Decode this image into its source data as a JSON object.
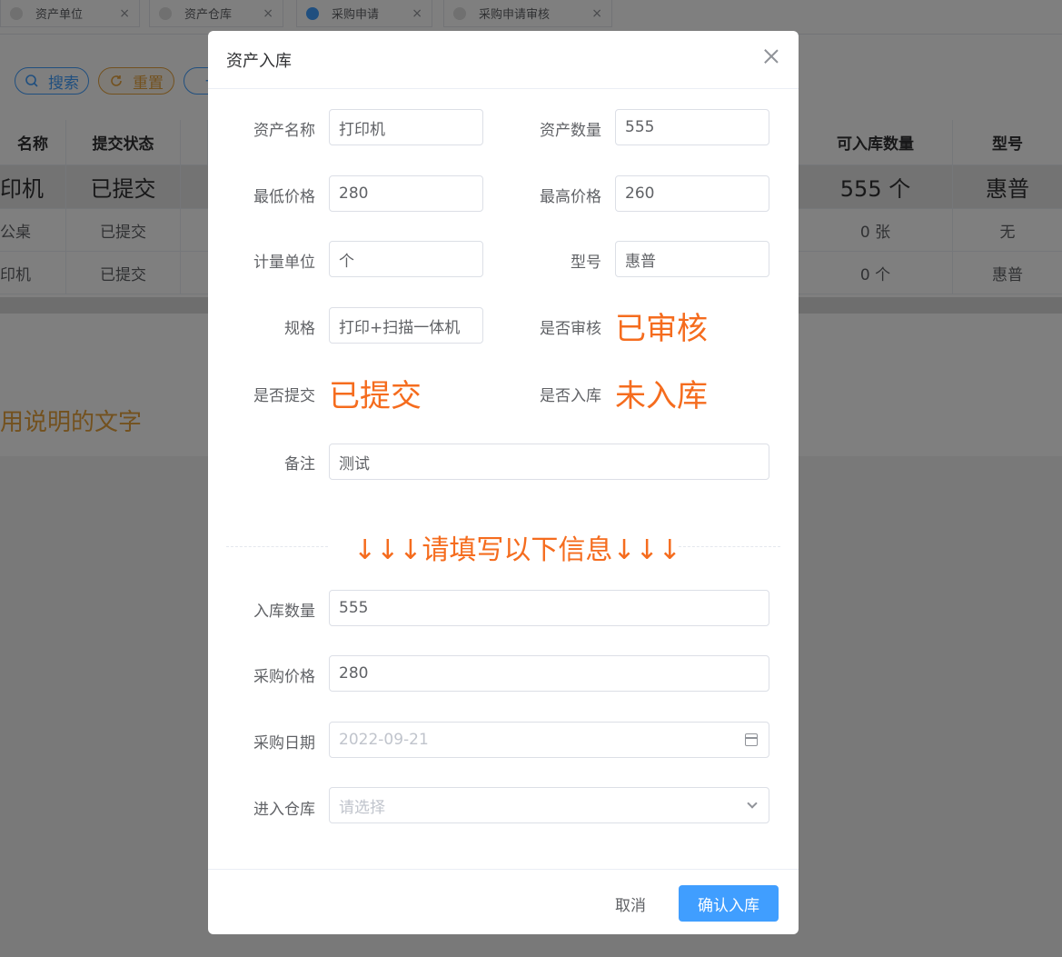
{
  "tabs": [
    {
      "label": "资产单位",
      "close": "×"
    },
    {
      "label": "资产仓库",
      "close": "×"
    },
    {
      "label": "采购申请",
      "close": "×"
    },
    {
      "label": "采购申请审核",
      "close": "×"
    }
  ],
  "toolbar": {
    "search_label": "搜索",
    "reset_label": "重置",
    "add_label": "+"
  },
  "table": {
    "headers": [
      "名称",
      "提交状态",
      "",
      "可入库数量",
      "型号"
    ],
    "rows": [
      [
        "印机",
        "已提交",
        "555 个",
        "惠普"
      ],
      [
        "公桌",
        "已提交",
        "0 张",
        "无"
      ],
      [
        "印机",
        "已提交",
        "0 个",
        "惠普"
      ]
    ]
  },
  "usage_text": "用说明的文字",
  "dialog": {
    "title": "资产入库",
    "fields": {
      "asset_name": {
        "label": "资产名称",
        "value": "打印机"
      },
      "asset_qty": {
        "label": "资产数量",
        "value": "555"
      },
      "min_price": {
        "label": "最低价格",
        "value": "280"
      },
      "max_price": {
        "label": "最高价格",
        "value": "260"
      },
      "unit": {
        "label": "计量单位",
        "value": "个"
      },
      "model": {
        "label": "型号",
        "value": "惠普"
      },
      "spec": {
        "label": "规格",
        "value": "打印+扫描一体机"
      },
      "audited": {
        "label": "是否审核",
        "value": "已审核"
      },
      "submitted": {
        "label": "是否提交",
        "value": "已提交"
      },
      "stored": {
        "label": "是否入库",
        "value": "未入库"
      },
      "remark": {
        "label": "备注",
        "value": "测试"
      }
    },
    "divider_text": "↓↓↓请填写以下信息↓↓↓",
    "form": {
      "in_qty": {
        "label": "入库数量",
        "value": "555"
      },
      "purchase_price": {
        "label": "采购价格",
        "value": "280"
      },
      "purchase_date": {
        "label": "采购日期",
        "placeholder": "2022-09-21"
      },
      "warehouse": {
        "label": "进入仓库",
        "placeholder": "请选择"
      }
    },
    "cancel_label": "取消",
    "confirm_label": "确认入库"
  },
  "colors": {
    "primary": "#409eff",
    "accent_orange": "#f56c1e",
    "warning": "#e6a23c"
  }
}
